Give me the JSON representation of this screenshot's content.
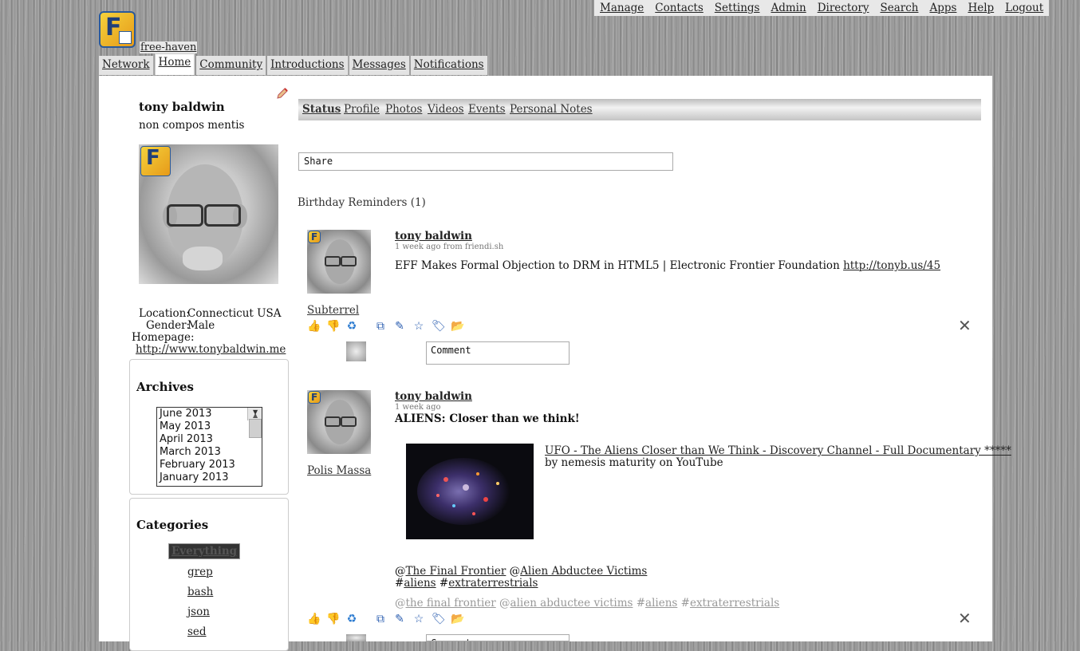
{
  "top_nav": [
    "Manage",
    "Contacts",
    "Settings",
    "Admin",
    "Directory",
    "Search",
    "Apps",
    "Help",
    "Logout"
  ],
  "site_name": "free-haven",
  "tabs": [
    "Network",
    "Home",
    "Community",
    "Introductions",
    "Messages",
    "Notifications"
  ],
  "active_tab": "Home",
  "profile": {
    "name": "tony baldwin",
    "tagline": "non compos mentis",
    "location_label": "Location:",
    "location": "Connecticut USA",
    "gender_label": "Gender:",
    "gender": "Male",
    "homepage_label": "Homepage:",
    "homepage": "http://www.tonybaldwin.me"
  },
  "archives": {
    "title": "Archives",
    "items": [
      "June 2013",
      "May 2013",
      "April 2013",
      "March 2013",
      "February 2013",
      "January 2013"
    ]
  },
  "categories": {
    "title": "Categories",
    "selected": "Everything",
    "items": [
      "grep",
      "bash",
      "json",
      "sed"
    ]
  },
  "sub_tabs": [
    "Status",
    "Profile",
    "Photos",
    "Videos",
    "Events",
    "Personal Notes"
  ],
  "share_placeholder": "Share",
  "birthday_reminders": "Birthday Reminders (1)",
  "posts": [
    {
      "author": "tony baldwin",
      "meta": "1 week ago from friendi.sh",
      "body_text": "EFF Makes Formal Objection to DRM in HTML5 | Electronic Frontier Foundation ",
      "body_link": "http://tonyb.us/45",
      "owner": "Subterrel",
      "comment_placeholder": "Comment"
    },
    {
      "author": "tony baldwin",
      "meta": "1 week ago",
      "title": "ALIENS: Closer than we think!",
      "video_title": "UFO - The Aliens Closer than We Think - Discovery Channel - Full Documentary *****",
      "video_by": "by nemesis maturity on YouTube",
      "owner": "Polis Massa",
      "mention1": "The Final Frontier",
      "mention2": "Alien Abductee Victims",
      "hashtag1": "aliens",
      "hashtag2": "extraterrestrials",
      "grey_tags": [
        "the final frontier",
        "alien abductee victims",
        "aliens",
        "extraterrestrials"
      ],
      "comment_placeholder": "Comment"
    }
  ]
}
